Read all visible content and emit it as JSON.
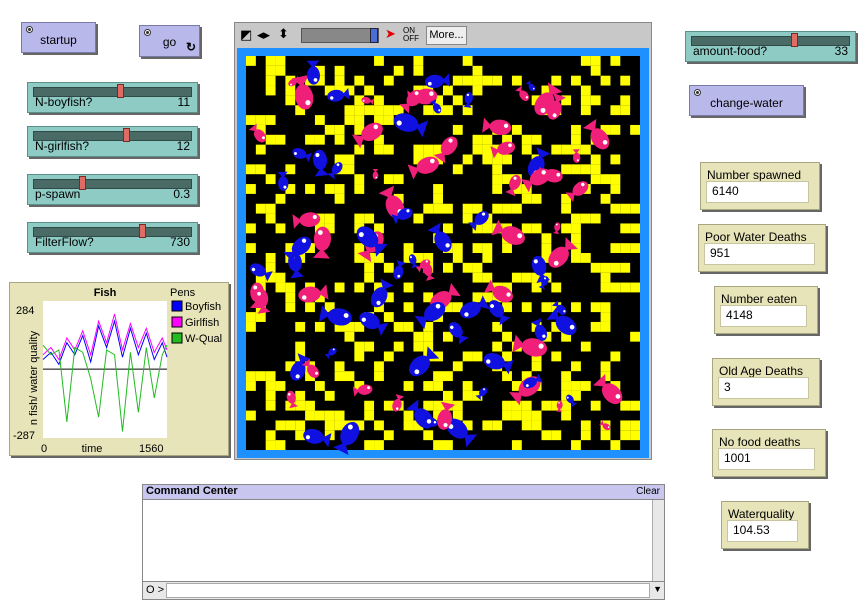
{
  "buttons": {
    "startup": "startup",
    "go": "go",
    "go_forever_glyph": "↻",
    "change_water": "change-water"
  },
  "sliders": [
    {
      "id": "n-boyfish",
      "label": "N-boyfish?",
      "value": "11",
      "fraction": 0.55
    },
    {
      "id": "n-girlfish",
      "label": "N-girlfish?",
      "value": "12",
      "fraction": 0.59
    },
    {
      "id": "p-spawn",
      "label": "p-spawn",
      "value": "0.3",
      "fraction": 0.3
    },
    {
      "id": "filterflow",
      "label": "FilterFlow?",
      "value": "730",
      "fraction": 0.7
    },
    {
      "id": "amount-food",
      "label": "amount-food?",
      "value": "33",
      "fraction": 0.66
    }
  ],
  "monitors": [
    {
      "id": "number-spawned",
      "label": "Number spawned",
      "value": "6140"
    },
    {
      "id": "poor-water-deaths",
      "label": "Poor Water Deaths",
      "value": "951"
    },
    {
      "id": "number-eaten",
      "label": "Number eaten",
      "value": "4148"
    },
    {
      "id": "old-age-deaths",
      "label": "Old Age Deaths",
      "value": "3"
    },
    {
      "id": "no-food-deaths",
      "label": "No food deaths",
      "value": "1001"
    },
    {
      "id": "waterquality",
      "label": "Waterquality",
      "value": "104.53"
    }
  ],
  "view": {
    "more_button": "More...",
    "onoff": "ON OFF",
    "toolbar_icons": [
      "contract-icon",
      "step-icon",
      "arrows-icon"
    ],
    "colors": {
      "border": "#1e90ff",
      "background": "#000000",
      "food": "#ffff00",
      "boyfish": "#1010e0",
      "girlfish": "#f0207a"
    }
  },
  "command_center": {
    "title": "Command Center",
    "clear": "Clear",
    "prompt": "O >"
  },
  "chart_data": {
    "type": "line",
    "title": "Fish",
    "xlabel": "time",
    "ylabel": "n fish/ water quality",
    "xlim": [
      0,
      1560
    ],
    "ylim": [
      -287,
      284
    ],
    "x_tick_labels": [
      "0",
      "1560"
    ],
    "y_tick_labels": [
      "284",
      "-287"
    ],
    "legend_title": "Pens",
    "grid": false,
    "legend_position": "right",
    "series": [
      {
        "name": "Boyfish",
        "color": "#0000ff",
        "x": [
          0,
          100,
          200,
          300,
          400,
          500,
          600,
          700,
          800,
          900,
          1000,
          1100,
          1200,
          1300,
          1400,
          1500,
          1560
        ],
        "values": [
          40,
          70,
          20,
          110,
          60,
          140,
          30,
          180,
          90,
          200,
          50,
          170,
          60,
          150,
          40,
          110,
          50
        ]
      },
      {
        "name": "Girlfish",
        "color": "#ff00ff",
        "x": [
          0,
          100,
          200,
          300,
          400,
          500,
          600,
          700,
          800,
          900,
          1000,
          1100,
          1200,
          1300,
          1400,
          1500,
          1560
        ],
        "values": [
          60,
          90,
          40,
          130,
          80,
          160,
          60,
          200,
          110,
          230,
          80,
          190,
          90,
          170,
          70,
          130,
          80
        ]
      },
      {
        "name": "W-Qual",
        "color": "#22bb22",
        "x": [
          0,
          100,
          200,
          300,
          400,
          500,
          600,
          700,
          800,
          900,
          1000,
          1100,
          1200,
          1300,
          1400,
          1500,
          1560
        ],
        "values": [
          100,
          60,
          80,
          -220,
          90,
          70,
          -40,
          -200,
          80,
          60,
          -260,
          70,
          -180,
          90,
          -120,
          60,
          100
        ]
      }
    ]
  }
}
